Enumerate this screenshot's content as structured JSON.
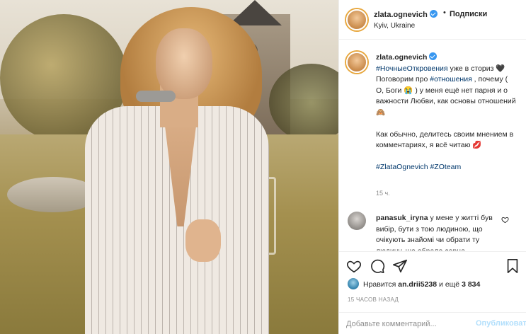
{
  "post": {
    "username": "zlata.ognevich",
    "follow_label": "Подписки",
    "separator": "•",
    "location": "Kyiv, Ukraine"
  },
  "caption": {
    "username": "zlata.ognevich",
    "hashtag1": "#НочныеОткровения",
    "text1": " уже в сториз 🖤",
    "text2": "Поговорим про ",
    "hashtag2": "#отношения",
    "text3": " , почему ( О, Боги 😭 ) у меня ещё нет парня и о важности Любви, как основы отношений 🙈",
    "text4": "Как обычно, делитесь своим мнением в комментариях, я всё читаю 💋",
    "hashtag3": "#ZlataOgnevich",
    "hashtag4": "#ZOteam",
    "time": "15 ч."
  },
  "comment": {
    "username": "panasuk_iryna",
    "text": " у мене у житті був вибір, бути з тою людиною, що очікують знайомі чи обрати ту людину, шо обрало серце"
  },
  "likes": {
    "prefix": "Нравится ",
    "user": "an.drii5238",
    "middle": " и ещё ",
    "count": "3 834"
  },
  "post_time": "15 ЧАСОВ НАЗАД",
  "add_comment": {
    "placeholder": "Добавьте комментарий...",
    "publish_label": "Опубликовать"
  },
  "colors": {
    "verified": "#3897f0",
    "hashtag": "#00376b",
    "publish_disabled": "#b2dffc",
    "story_ring": "#e8a83f"
  },
  "icons": [
    "verified-badge-icon",
    "heart-icon",
    "comment-icon",
    "share-icon",
    "bookmark-icon",
    "comment-like-icon"
  ]
}
